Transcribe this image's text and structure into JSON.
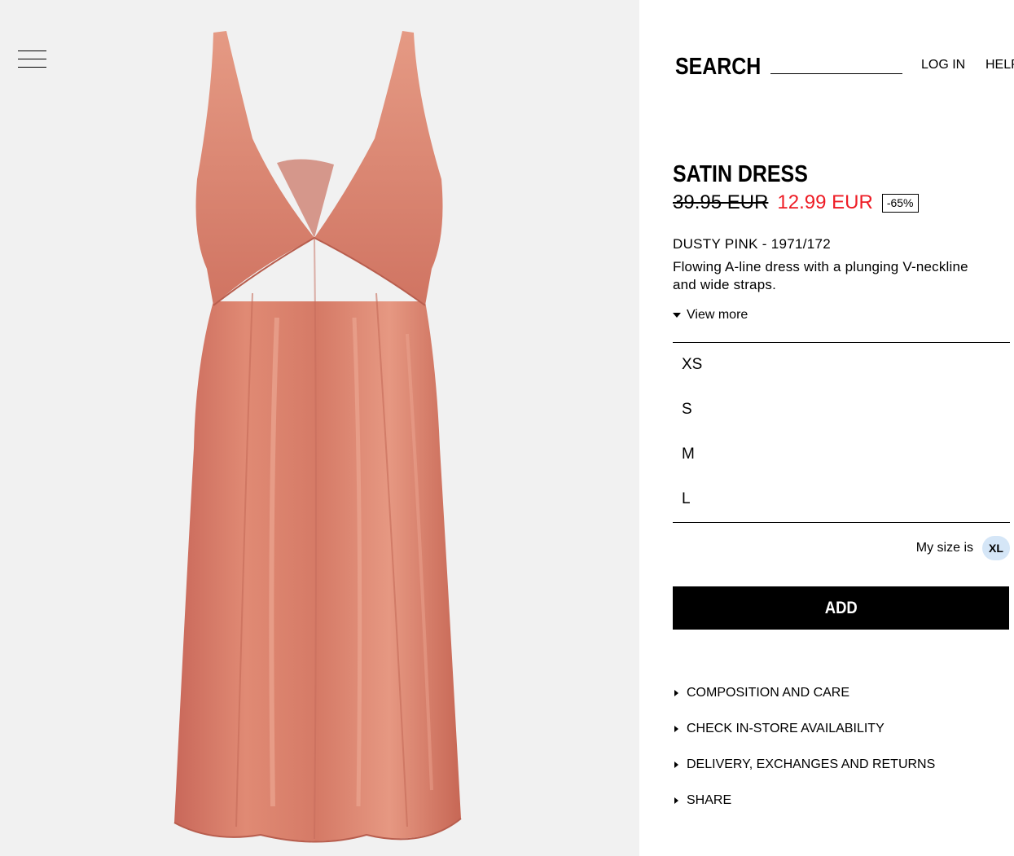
{
  "header": {
    "search_label": "SEARCH",
    "search_value": "",
    "login_label": "LOG IN",
    "help_label": "HELP"
  },
  "product": {
    "title": "SATIN DRESS",
    "old_price": "39.95 EUR",
    "new_price": "12.99 EUR",
    "discount": "-65%",
    "color_ref": "DUSTY PINK - 1971/172",
    "description": "Flowing A-line dress with a plunging V-neckline and wide straps.",
    "view_more_label": "View more"
  },
  "sizes": [
    {
      "label": "XS"
    },
    {
      "label": "S"
    },
    {
      "label": "M"
    },
    {
      "label": "L"
    }
  ],
  "my_size": {
    "label": "My size is",
    "value": "XL"
  },
  "add_button_label": "ADD",
  "info_links": [
    {
      "label": "COMPOSITION AND CARE"
    },
    {
      "label": "CHECK IN-STORE AVAILABILITY"
    },
    {
      "label": "DELIVERY, EXCHANGES AND RETURNS"
    },
    {
      "label": "SHARE"
    }
  ],
  "colors": {
    "image_background": "#f1f1f1",
    "dress": "#d97d68",
    "sale_price": "#ee1c25",
    "my_size_badge": "#d5e6f7",
    "button": "#000000"
  },
  "icons": {
    "menu": "hamburger-menu-icon"
  }
}
